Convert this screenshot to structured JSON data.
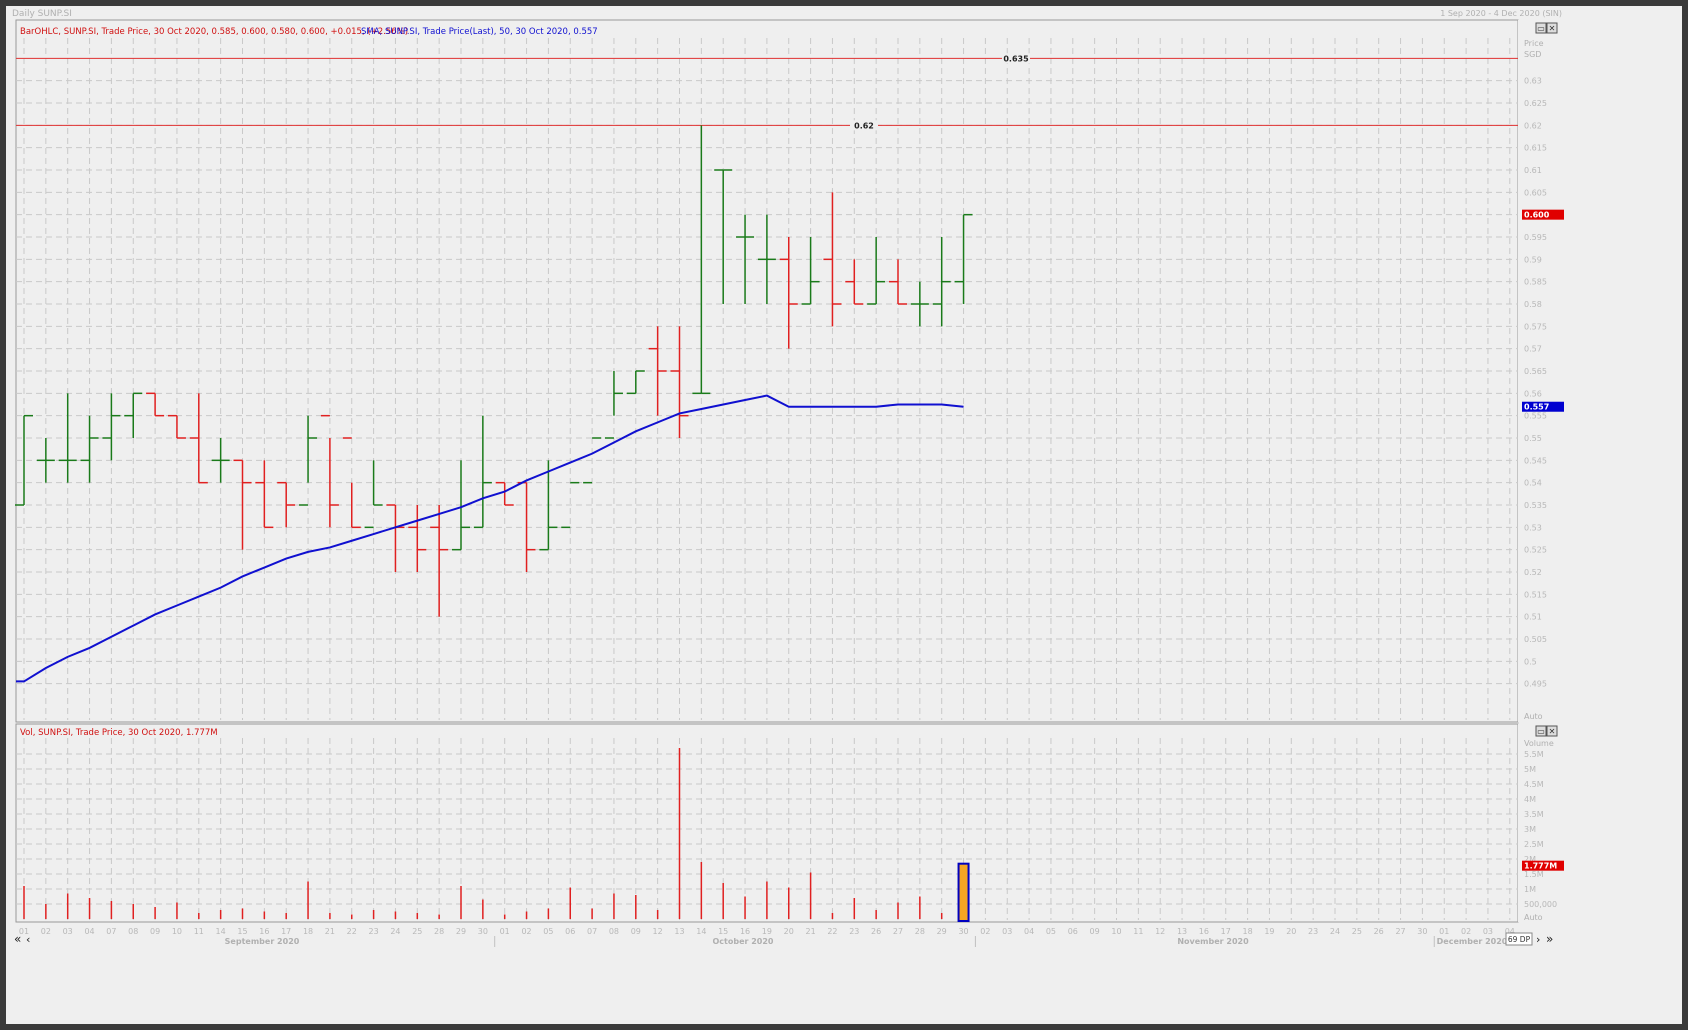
{
  "window": {
    "title": "Daily SUNP.SI",
    "range": "1 Sep 2020 - 4 Dec 2020 (SIN)",
    "dp_label": "69 DP"
  },
  "price_panel": {
    "legend_main": "BarOHLC, SUNP.SI, Trade Price, 30 Oct 2020, 0.585, 0.600, 0.580, 0.600, +0.015, (+2.56%)",
    "legend_sma": "SMA, SUNP.SI, Trade Price(Last), 50, 30 Oct 2020, 0.557",
    "axis_title": "Price",
    "axis_unit": "SGD",
    "auto_label": "Auto",
    "last_price_tag": "0.600",
    "sma_tag": "0.557",
    "hline_labels": [
      "0.635",
      "0.62"
    ]
  },
  "volume_panel": {
    "legend": "Vol, SUNP.SI, Trade Price, 30 Oct 2020, 1.777M",
    "axis_title": "Volume",
    "auto_label": "Auto",
    "last_volume_tag": "1.777M"
  },
  "x_axis": {
    "day_labels": [
      "01",
      "02",
      "03",
      "04",
      "07",
      "08",
      "09",
      "10",
      "11",
      "14",
      "15",
      "16",
      "17",
      "18",
      "21",
      "22",
      "23",
      "24",
      "25",
      "28",
      "29",
      "30",
      "01",
      "02",
      "05",
      "06",
      "07",
      "08",
      "09",
      "12",
      "13",
      "14",
      "15",
      "16",
      "19",
      "20",
      "21",
      "22",
      "23",
      "26",
      "27",
      "28",
      "29",
      "30",
      "02",
      "03",
      "04",
      "05",
      "06",
      "09",
      "10",
      "11",
      "12",
      "13",
      "16",
      "17",
      "18",
      "19",
      "20",
      "23",
      "24",
      "25",
      "26",
      "27",
      "30",
      "01",
      "02",
      "03",
      "04"
    ],
    "month_labels": [
      "September 2020",
      "October 2020",
      "November 2020",
      "December 2020"
    ]
  },
  "colors": {
    "up": "#1a7a1a",
    "down": "#e02020",
    "sma": "#1010d0",
    "hline": "#e03030",
    "grid": "#c9c9c9",
    "background": "#efefef"
  },
  "chart_data": [
    {
      "type": "ohlc",
      "series_name": "SUNP.SI",
      "dates": [
        "01 Sep",
        "02 Sep",
        "03 Sep",
        "04 Sep",
        "07 Sep",
        "08 Sep",
        "09 Sep",
        "10 Sep",
        "11 Sep",
        "14 Sep",
        "15 Sep",
        "16 Sep",
        "17 Sep",
        "18 Sep",
        "21 Sep",
        "22 Sep",
        "23 Sep",
        "24 Sep",
        "25 Sep",
        "28 Sep",
        "29 Sep",
        "30 Sep",
        "01 Oct",
        "02 Oct",
        "05 Oct",
        "06 Oct",
        "07 Oct",
        "08 Oct",
        "09 Oct",
        "12 Oct",
        "13 Oct",
        "14 Oct",
        "15 Oct",
        "16 Oct",
        "19 Oct",
        "20 Oct",
        "21 Oct",
        "22 Oct",
        "23 Oct",
        "26 Oct",
        "27 Oct",
        "28 Oct",
        "29 Oct",
        "30 Oct"
      ],
      "open": [
        0.535,
        0.545,
        0.545,
        0.545,
        0.55,
        0.555,
        0.56,
        0.555,
        0.55,
        0.545,
        0.545,
        0.54,
        0.54,
        0.535,
        0.555,
        0.55,
        0.53,
        0.535,
        0.53,
        0.53,
        0.525,
        0.53,
        0.54,
        0.54,
        0.525,
        0.53,
        0.54,
        0.55,
        0.56,
        0.57,
        0.565,
        0.56,
        0.61,
        0.595,
        0.59,
        0.59,
        0.58,
        0.59,
        0.585,
        0.58,
        0.585,
        0.58,
        0.58,
        0.585
      ],
      "high": [
        0.555,
        0.55,
        0.56,
        0.555,
        0.56,
        0.56,
        0.56,
        0.555,
        0.56,
        0.55,
        0.545,
        0.545,
        0.54,
        0.555,
        0.55,
        0.54,
        0.545,
        0.535,
        0.535,
        0.535,
        0.545,
        0.555,
        0.54,
        0.54,
        0.545,
        0.54,
        0.555,
        0.565,
        0.565,
        0.575,
        0.575,
        0.62,
        0.61,
        0.6,
        0.6,
        0.595,
        0.595,
        0.605,
        0.59,
        0.595,
        0.59,
        0.585,
        0.595,
        0.6
      ],
      "low": [
        0.535,
        0.54,
        0.54,
        0.54,
        0.545,
        0.55,
        0.555,
        0.55,
        0.54,
        0.54,
        0.525,
        0.53,
        0.53,
        0.54,
        0.53,
        0.53,
        0.535,
        0.52,
        0.52,
        0.51,
        0.525,
        0.53,
        0.535,
        0.52,
        0.525,
        0.54,
        0.555,
        0.555,
        0.56,
        0.555,
        0.55,
        0.56,
        0.58,
        0.58,
        0.58,
        0.57,
        0.58,
        0.575,
        0.58,
        0.58,
        0.58,
        0.575,
        0.575,
        0.58
      ],
      "close": [
        0.555,
        0.545,
        0.545,
        0.55,
        0.555,
        0.56,
        0.555,
        0.55,
        0.54,
        0.545,
        0.54,
        0.53,
        0.535,
        0.55,
        0.535,
        0.53,
        0.535,
        0.53,
        0.525,
        0.525,
        0.53,
        0.54,
        0.535,
        0.525,
        0.53,
        0.54,
        0.55,
        0.56,
        0.565,
        0.565,
        0.555,
        0.56,
        0.61,
        0.595,
        0.59,
        0.58,
        0.585,
        0.58,
        0.58,
        0.585,
        0.58,
        0.58,
        0.585,
        0.6
      ],
      "ylim": [
        0.49,
        0.64
      ],
      "y_ticks": [
        0.495,
        0.5,
        0.505,
        0.51,
        0.515,
        0.52,
        0.525,
        0.53,
        0.535,
        0.54,
        0.545,
        0.55,
        0.555,
        0.56,
        0.565,
        0.57,
        0.575,
        0.58,
        0.585,
        0.59,
        0.595,
        0.6,
        0.605,
        0.61,
        0.615,
        0.62,
        0.625,
        0.63
      ],
      "horizontal_lines": [
        0.635,
        0.62
      ],
      "grid": true
    },
    {
      "type": "line",
      "series_name": "SMA 50",
      "values": [
        0.4955,
        0.4985,
        0.501,
        0.503,
        0.5055,
        0.508,
        0.5105,
        0.5125,
        0.5145,
        0.5165,
        0.519,
        0.521,
        0.523,
        0.5245,
        0.5255,
        0.527,
        0.5285,
        0.53,
        0.5315,
        0.533,
        0.5345,
        0.5365,
        0.538,
        0.5405,
        0.5425,
        0.5445,
        0.5465,
        0.549,
        0.5515,
        0.5535,
        0.5555,
        0.5565,
        0.5575,
        0.5585,
        0.5595,
        0.557,
        0.557,
        0.557,
        0.557,
        0.557,
        0.5575,
        0.5575,
        0.5575,
        0.557
      ]
    },
    {
      "type": "bar",
      "series_name": "Volume",
      "categories_ref": "dates",
      "values": [
        1.1,
        0.5,
        0.85,
        0.7,
        0.6,
        0.5,
        0.4,
        0.55,
        0.2,
        0.3,
        0.35,
        0.25,
        0.2,
        1.25,
        0.2,
        0.15,
        0.3,
        0.25,
        0.2,
        0.15,
        1.1,
        0.65,
        0.15,
        0.25,
        0.35,
        1.05,
        0.35,
        0.85,
        0.8,
        0.3,
        5.7,
        1.9,
        1.2,
        0.75,
        1.25,
        1.05,
        1.55,
        0.2,
        0.7,
        0.3,
        0.55,
        0.75,
        0.2,
        1.777
      ],
      "unit": "M",
      "ylim": [
        0,
        6
      ],
      "y_tick_labels": [
        "500,000",
        "1M",
        "1.5M",
        "2M",
        "2.5M",
        "3M",
        "3.5M",
        "4M",
        "4.5M",
        "5M",
        "5.5M"
      ],
      "y_tick_values": [
        0.5,
        1,
        1.5,
        2,
        2.5,
        3,
        3.5,
        4,
        4.5,
        5,
        5.5
      ]
    }
  ]
}
